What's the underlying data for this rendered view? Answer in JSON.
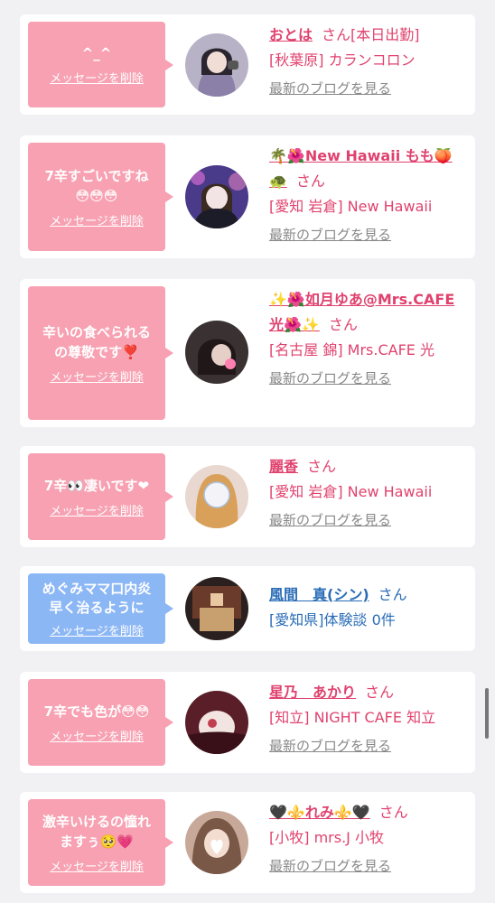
{
  "cards": [
    {
      "message": "^_^",
      "delete_label": "メッセージを削除",
      "name": "おとは",
      "san": "さん",
      "san_suffix": "[本日出勤]",
      "shop": "[秋葉原] カランコロン",
      "blog": "最新のブログを見る",
      "color": "pink"
    },
    {
      "message": "7辛すごいですね😳😳😳",
      "delete_label": "メッセージを削除",
      "name": "🌴🌺New Hawaii もも🍑🐢",
      "san": "さん",
      "shop": "[愛知 岩倉] New Hawaii",
      "blog": "最新のブログを見る",
      "color": "pink"
    },
    {
      "message": "辛いの食べられるの尊敬です❣️",
      "delete_label": "メッセージを削除",
      "name": "✨🌺如月ゆあ@Mrs.CAFE光🌺✨",
      "san": "さん",
      "shop": "[名古屋 錦] Mrs.CAFE 光",
      "blog": "最新のブログを見る",
      "color": "pink"
    },
    {
      "message": "7辛👀凄いです❤",
      "delete_label": "メッセージを削除",
      "name": "麗香",
      "san": "さん",
      "shop": "[愛知 岩倉] New Hawaii",
      "blog": "最新のブログを見る",
      "color": "pink"
    },
    {
      "message": "めぐみママ口内炎早く治るように",
      "delete_label": "メッセージを削除",
      "name": "風間　真(シン)",
      "san": "さん",
      "shop": "[愛知県]体験談 0件",
      "color": "blue"
    },
    {
      "message": "7辛でも色が😳😳",
      "delete_label": "メッセージを削除",
      "name": "星乃　あかり",
      "san": "さん",
      "shop": "[知立] NIGHT CAFE 知立",
      "blog": "最新のブログを見る",
      "color": "pink"
    },
    {
      "message": "激辛いけるの憧れますぅ🥺💗",
      "delete_label": "メッセージを削除",
      "name": "🖤⚜️れみ⚜️🖤",
      "san": "さん",
      "shop": "[小牧] mrs.J 小牧",
      "blog": "最新のブログを見る",
      "color": "pink"
    }
  ],
  "colors": {
    "pink_bubble": "#f7a1b2",
    "blue_bubble": "#8cb7f5",
    "pink_text": "#e0426e",
    "blue_text": "#2a6db7",
    "background": "#f1f1f3"
  }
}
